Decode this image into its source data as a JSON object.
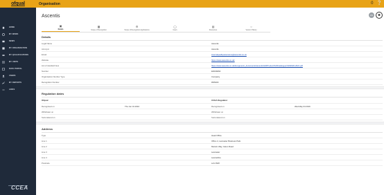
{
  "topbar": {
    "logo": "ofqual",
    "title": "Organisation",
    "icons": [
      "bell-icon",
      "help-icon"
    ],
    "right_text": "0"
  },
  "sidebar": {
    "items": [
      {
        "icon": "home-icon",
        "label": "HOME"
      },
      {
        "icon": "my-work-icon",
        "label": "MY WORK"
      },
      {
        "icon": "news-icon",
        "label": "NEWS"
      },
      {
        "icon": "organisation-icon",
        "label": "MY ORGANISATION"
      },
      {
        "icon": "qualifications-icon",
        "label": "MY QUALIFICATIONS"
      },
      {
        "icon": "units-icon",
        "label": "MY UNITS"
      },
      {
        "icon": "data-portal-icon",
        "label": "DATA PORTAL"
      },
      {
        "icon": "users-icon",
        "label": "USERS"
      },
      {
        "icon": "reports-icon",
        "label": "MY REPORTS"
      },
      {
        "icon": "links-icon",
        "label": "LINKS"
      }
    ],
    "footer_logo": "CCEA"
  },
  "header": {
    "title": "Ascentis",
    "avatar_initials": "AS"
  },
  "tabs": [
    {
      "icon": "details-icon",
      "label": "Details",
      "active": true
    },
    {
      "icon": "scope-icon",
      "label": "Scope of Recognition",
      "active": false
    },
    {
      "icon": "scope-app-icon",
      "label": "Scope of Recognition Applications",
      "active": false
    },
    {
      "icon": "users-tab-icon",
      "label": "Users",
      "active": false
    },
    {
      "icon": "resources-icon",
      "label": "Resources",
      "active": false
    },
    {
      "icon": "history-icon",
      "label": "Version History",
      "active": false
    }
  ],
  "details": {
    "section_title": "Details",
    "rows": [
      {
        "key": "Legal Name",
        "value": "Ascentis",
        "link": false
      },
      {
        "key": "Acronym",
        "value": "Ascentis",
        "link": false
      },
      {
        "key": "Email",
        "value": "internalqualityassurance@ascentis.co.uk",
        "link": true
      },
      {
        "key": "Website",
        "value": "https://www.ascentis.co.uk/",
        "link": true
      },
      {
        "key": "List of standard fees",
        "value": "https://www.ascentis.co.uk/dev/generic_documents/Ascentis%20Product%20Catalogue%202020-2021.pdf",
        "link": true
      },
      {
        "key": "Number",
        "value": "ED199264",
        "link": false
      },
      {
        "key": "Organisation Number Type",
        "value": "Company",
        "link": false
      },
      {
        "key": "Recognition Number",
        "value": "RN5203",
        "link": false
      }
    ]
  },
  "regulation": {
    "section_title": "Regulation dates",
    "left_head": "Ofqual",
    "right_head": "CCEA Regulator",
    "rows": [
      {
        "k1": "Recognised on",
        "v1": "Thu Jun 01 2010",
        "k2": "Recognised on",
        "v2": "Wed May 04 2016"
      },
      {
        "k1": "Withdrawn on",
        "v1": "",
        "k2": "Withdrawn on",
        "v2": ""
      },
      {
        "k1": "Surrendered on",
        "v1": "",
        "k2": "Surrendered on",
        "v2": ""
      }
    ]
  },
  "address": {
    "section_title": "Address",
    "rows": [
      {
        "key": "Type",
        "value": "Head Office"
      },
      {
        "key": "Line 1",
        "value": "Office 4, Lancaster Business Park"
      },
      {
        "key": "Line 2",
        "value": "Mannin Way, Caton Road"
      },
      {
        "key": "Line 3",
        "value": "Lancaster"
      },
      {
        "key": "Line 4",
        "value": "Lancashire"
      },
      {
        "key": "Postcode",
        "value": "LA1 3SW"
      }
    ]
  }
}
